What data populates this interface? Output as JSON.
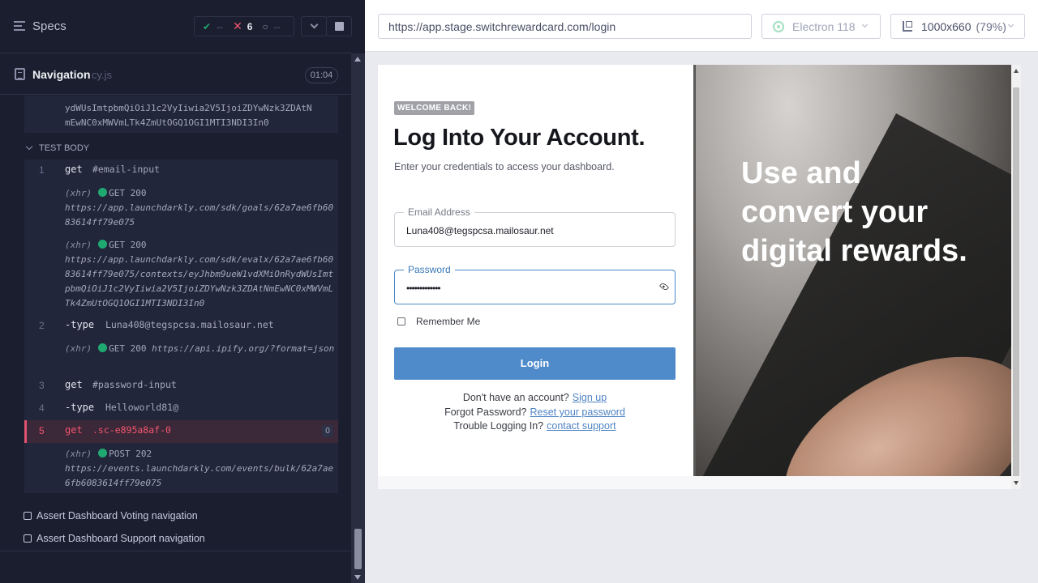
{
  "reporter": {
    "specs_label": "Specs",
    "stats": {
      "passed": "--",
      "failed": "6",
      "pending": "--"
    },
    "spec": {
      "name": "Navigation",
      "ext": "cy.js",
      "duration": "01:04"
    },
    "log": {
      "top_lines": [
        "ydWUsImtpbmQiOiJ1c2VyIiwia2V5IjoiZDYwNzk3ZDAtN",
        "mEwNC0xMWVmLTk4ZmUtOGQ1OGI1MTI3NDI3In0"
      ],
      "section_label": "TEST BODY",
      "commands": [
        {
          "num": "1",
          "name": "get",
          "arg": "#email-input"
        },
        {
          "num": "2",
          "name": "-type",
          "arg": "Luna408@tegspcsa.mailosaur.net"
        },
        {
          "num": "3",
          "name": "get",
          "arg": "#password-input"
        },
        {
          "num": "4",
          "name": "-type",
          "arg": "Helloworld81@"
        },
        {
          "num": "5",
          "name": "get",
          "arg": ".sc-e895a8af-0",
          "count": "0"
        }
      ],
      "xhr": [
        {
          "tag": "(xhr)",
          "method": "GET 200",
          "url": "https://app.launchdarkly.com/sdk/goals/62a7ae6fb6083614ff79e075"
        },
        {
          "tag": "(xhr)",
          "method": "GET 200",
          "url": "https://app.launchdarkly.com/sdk/evalx/62a7ae6fb6083614ff79e075/contexts/eyJhbm9ueW1vdXMiOnRydWUsImtpbmQiOiJ1c2VyIiwia2V5IjoiZDYwNzk3ZDAtNmEwNC0xMWVmLTk4ZmUtOGQ1OGI1MTI3NDI3In0"
        },
        {
          "tag": "(xhr)",
          "method": "GET 200",
          "url": "https://api.ipify.org/?format=json"
        },
        {
          "tag": "(xhr)",
          "method": "POST 202",
          "url": "https://events.launchdarkly.com/events/bulk/62a7ae6fb6083614ff79e075"
        }
      ],
      "other_tests": [
        "Assert Dashboard Voting navigation",
        "Assert Dashboard Support navigation"
      ]
    }
  },
  "browser_bar": {
    "url": "https://app.stage.switchrewardcard.com/login",
    "browser": "Electron 118",
    "viewport": "1000x660",
    "zoom": "(79%)"
  },
  "app": {
    "badge": "WELCOME BACK!",
    "heading": "Log Into Your Account.",
    "subtitle": "Enter your credentials to access your dashboard.",
    "email_label": "Email Address",
    "email_value": "Luna408@tegspcsa.mailosaur.net",
    "password_label": "Password",
    "password_value": "•••••••••••••",
    "remember_label": "Remember Me",
    "login_label": "Login",
    "signup_prompt": "Don't have an account?",
    "signup_link": "Sign up",
    "forgot_prompt": "Forgot Password?",
    "forgot_link": "Reset your password",
    "trouble_prompt": "Trouble Logging In?",
    "trouble_link": "contact support",
    "hero_text": "Use and convert your digital rewards."
  },
  "colors": {
    "fail": "#f4566f",
    "pass": "#1fa971",
    "login_button": "#4f8bcb"
  }
}
